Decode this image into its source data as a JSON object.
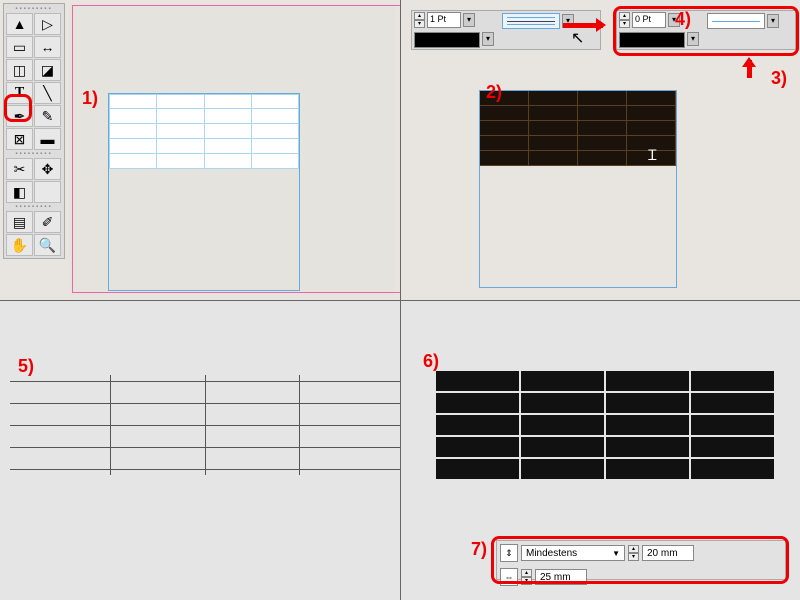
{
  "annotations": {
    "step1": "1)",
    "step2": "2)",
    "step3": "3)",
    "step4": "4)",
    "step5": "5)",
    "step6": "6)",
    "step7": "7)"
  },
  "toolbar": {
    "tools": [
      "arrow-black",
      "arrow-white",
      "page",
      "gap",
      "chart1",
      "chart2",
      "text-T",
      "line",
      "pen",
      "pencil",
      "rect",
      "rect-fill",
      "scissors",
      "transform",
      "gradient",
      "blank",
      "note",
      "eyedropper",
      "hand",
      "zoom"
    ]
  },
  "stroke_panel_left": {
    "weight": "1 Pt"
  },
  "stroke_panel_right": {
    "weight": "0 Pt"
  },
  "row_height_panel": {
    "mode": "Mindestens",
    "row_h": "20 mm",
    "col_w": "25 mm"
  },
  "grids": {
    "light_rows": 5,
    "light_cols": 4,
    "dark_rows": 5,
    "dark_cols": 4,
    "plain_rows": 4,
    "plain_cols": 4,
    "dark2_rows": 5,
    "dark2_cols": 4
  }
}
